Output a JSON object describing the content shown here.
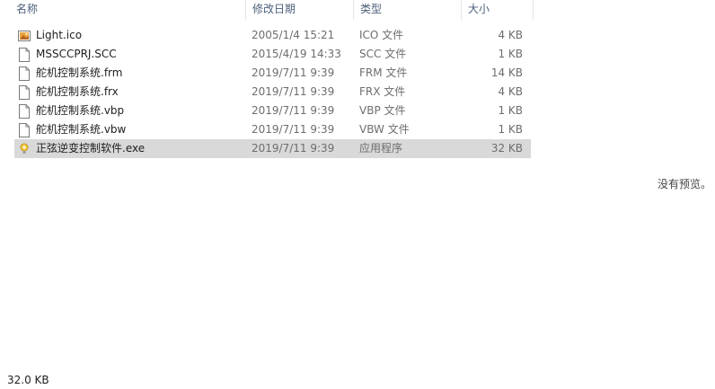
{
  "header": {
    "name": "名称",
    "date": "修改日期",
    "type": "类型",
    "size": "大小"
  },
  "files": [
    {
      "name": "Light.ico",
      "date": "2005/1/4 15:21",
      "type": "ICO 文件",
      "size": "4 KB",
      "icon": "image-file-icon",
      "selected": false
    },
    {
      "name": "MSSCCPRJ.SCC",
      "date": "2015/4/19 14:33",
      "type": "SCC 文件",
      "size": "1 KB",
      "icon": "blank-file-icon",
      "selected": false
    },
    {
      "name": "舵机控制系统.frm",
      "date": "2019/7/11 9:39",
      "type": "FRM 文件",
      "size": "14 KB",
      "icon": "blank-file-icon",
      "selected": false
    },
    {
      "name": "舵机控制系统.frx",
      "date": "2019/7/11 9:39",
      "type": "FRX 文件",
      "size": "4 KB",
      "icon": "blank-file-icon",
      "selected": false
    },
    {
      "name": "舵机控制系统.vbp",
      "date": "2019/7/11 9:39",
      "type": "VBP 文件",
      "size": "1 KB",
      "icon": "blank-file-icon",
      "selected": false
    },
    {
      "name": "舵机控制系统.vbw",
      "date": "2019/7/11 9:39",
      "type": "VBW 文件",
      "size": "1 KB",
      "icon": "blank-file-icon",
      "selected": false
    },
    {
      "name": "正弦逆变控制软件.exe",
      "date": "2019/7/11 9:39",
      "type": "应用程序",
      "size": "32 KB",
      "icon": "application-icon",
      "selected": true
    }
  ],
  "preview": {
    "message": "没有预览。"
  },
  "status": {
    "selected_size": "32.0 KB"
  },
  "colors": {
    "selected_row": "#d9d9d9",
    "header_text": "#4c607a",
    "secondary_text": "#6d6d6d"
  }
}
